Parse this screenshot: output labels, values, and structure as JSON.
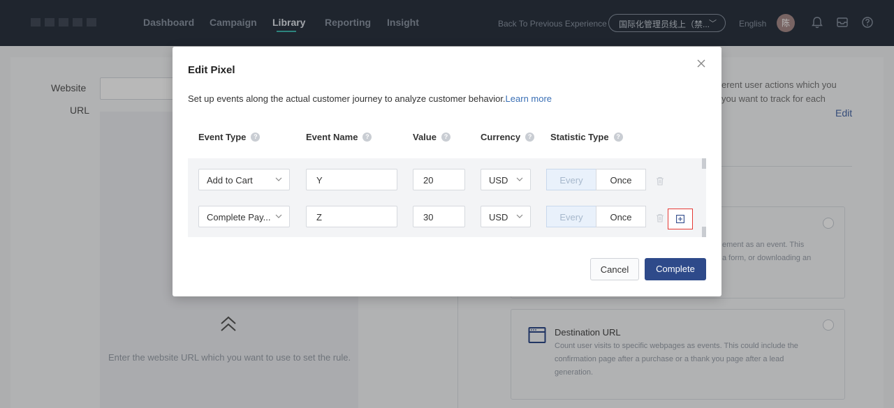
{
  "nav": {
    "items": [
      {
        "label": "Dashboard",
        "active": false
      },
      {
        "label": "Campaign",
        "active": false
      },
      {
        "label": "Library",
        "active": true
      },
      {
        "label": "Reporting",
        "active": false
      },
      {
        "label": "Insight",
        "active": false
      }
    ],
    "back_link": "Back To Previous Experience",
    "account": "国际化管理员线上（禁...",
    "language": "English",
    "avatar": "陈",
    "icons": [
      "bell-icon",
      "inbox-icon",
      "help-icon"
    ]
  },
  "background": {
    "website_label": "Website",
    "url_label": "URL",
    "hint": "Enter the website URL which you want to use to set the rule.",
    "right_text_1": "erent user actions which you",
    "right_text_2": "you want to track for each",
    "edit": "Edit",
    "option1_line1": "ement as an event. This",
    "option1_line2": "a form, or downloading an",
    "option2_title": "Destination URL",
    "option2_desc": [
      "Count user visits to specific webpages as events. This could include the",
      "confirmation page after a purchase or a thank you page after a lead",
      "generation."
    ]
  },
  "modal": {
    "title": "Edit Pixel",
    "description": "Set up events along the actual customer journey to analyze customer behavior.",
    "learn_more": "Learn more",
    "columns": {
      "event_type": "Event Type",
      "event_name": "Event Name",
      "value": "Value",
      "currency": "Currency",
      "statistic_type": "Statistic Type"
    },
    "rows": [
      {
        "event_type": "Add to Cart",
        "event_name": "Y",
        "value": "20",
        "currency": "USD",
        "every": "Every",
        "once": "Once",
        "selected": "Every"
      },
      {
        "event_type": "Complete Pay...",
        "event_name": "Z",
        "value": "30",
        "currency": "USD",
        "every": "Every",
        "once": "Once",
        "selected": "Every"
      }
    ],
    "cancel": "Cancel",
    "complete": "Complete"
  },
  "colors": {
    "nav_bg": "#2b3441",
    "primary": "#2e4a8a",
    "link": "#3a6fb5",
    "highlight_border": "#e53935",
    "active_underline": "#3fb7ae"
  }
}
